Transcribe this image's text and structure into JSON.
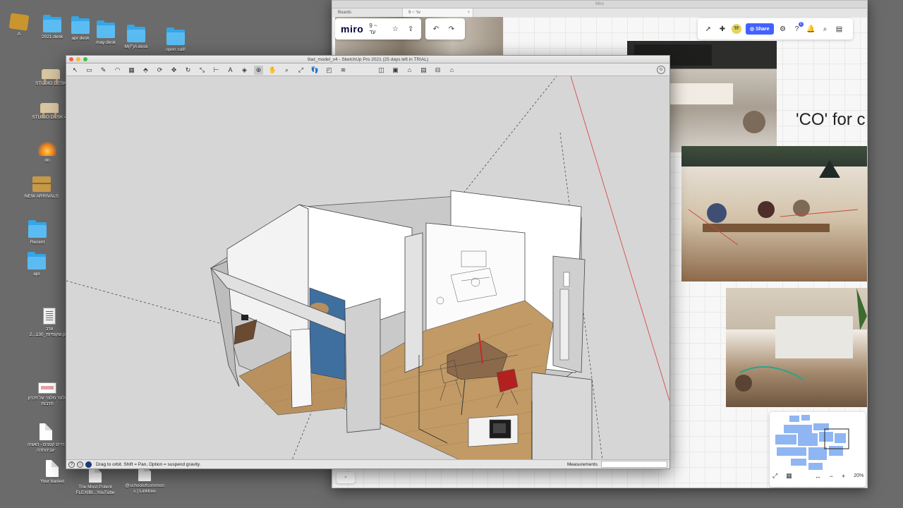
{
  "desktop": {
    "icons": [
      {
        "label": "A",
        "kind": "cube"
      },
      {
        "label": "2021 desk",
        "kind": "folder"
      },
      {
        "label": "apr desk",
        "kind": "folder"
      },
      {
        "label": "may desk",
        "kind": "folder"
      },
      {
        "label": "M(F)A desk",
        "kind": "folder"
      },
      {
        "label": "open call!",
        "kind": "folder"
      },
      {
        "label": "STUDIO DESK",
        "kind": "table"
      },
      {
        "label": "STUDIO DESK 4",
        "kind": "table"
      },
      {
        "label": "do",
        "kind": "fire"
      },
      {
        "label": "NEW ARRIVALS",
        "kind": "box"
      },
      {
        "label": "Recent",
        "kind": "folder"
      },
      {
        "label": "apr",
        "kind": "folder"
      },
      {
        "label": "ערב\n2...130_שקופיות.pdf",
        "kind": "pdf"
      },
      {
        "label": "גלעד מלצר על זיכרון\nחרבות",
        "kind": "thumb"
      },
      {
        "label": "חיים קטנים - האגיה\nיגביהתדה",
        "kind": "doc"
      },
      {
        "label": "Your basket",
        "kind": "doc"
      },
      {
        "label": "The Most Potent\nFLEXIBI...YouTube",
        "kind": "doc"
      },
      {
        "label": "@schoolofcommon\ns | Linktree",
        "kind": "doc"
      }
    ]
  },
  "miro": {
    "window_title": "Miro",
    "tabs": [
      {
        "label": "Boards"
      },
      {
        "label": "9 ~ עד",
        "active": true
      }
    ],
    "logo": "miro",
    "board_name": "9 ~ עד",
    "share_label": "Share",
    "avatar_initials": "TF",
    "notification_count": "1",
    "headline": "'CO' for c",
    "zoom_level": "20%",
    "icons": {
      "upload": "upload-icon",
      "undo": "undo-icon",
      "redo": "redo-icon",
      "cursor": "cursor-icon",
      "reaction": "reaction-icon",
      "settings": "sliders-icon",
      "help": "help-icon",
      "bell": "bell-icon",
      "search": "search-icon",
      "notes": "notes-icon"
    },
    "colors": {
      "accent": "#4262ff",
      "brand": "#050038"
    }
  },
  "sketchup": {
    "window_title": "9ad_model_v4 - SketchUp Pro 2021 (25 days left in TRIAL)",
    "status_hint": "Drag to orbit. Shift = Pan, Option = suspend gravity.",
    "measurements_label": "Measurements",
    "measurements_value": "",
    "toolbar": [
      "select-tool",
      "eraser-tool",
      "line-tool",
      "arc-tool",
      "shape-tool",
      "push-pull-tool",
      "follow-me-tool",
      "move-tool",
      "rotate-tool",
      "scale-tool",
      "tape-measure-tool",
      "text-tool",
      "paint-bucket-tool",
      "orbit-tool",
      "pan-tool",
      "zoom-tool",
      "zoom-extents-tool",
      "walk-tool",
      "section-plane-tool",
      "layers-tool",
      "iso-view",
      "top-view",
      "front-view",
      "right-view",
      "back-view",
      "left-view"
    ]
  }
}
